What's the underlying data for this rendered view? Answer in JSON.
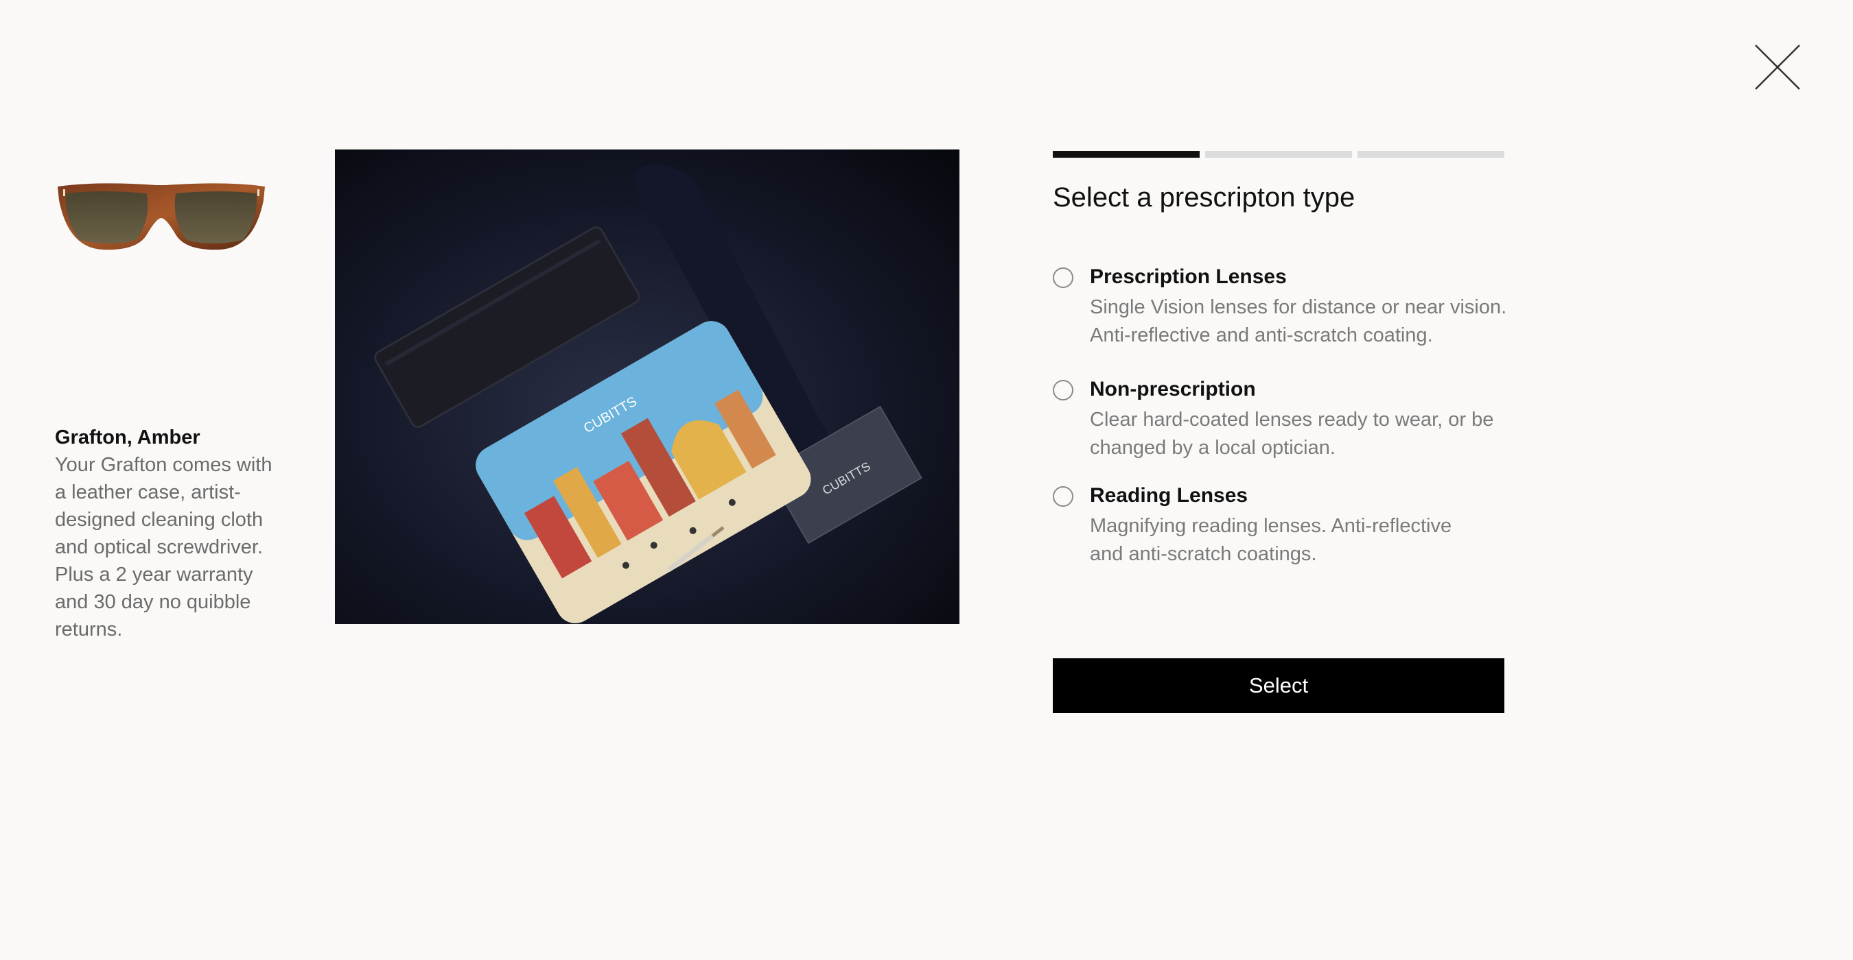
{
  "product": {
    "name": "Grafton, Amber",
    "description": "Your Grafton comes with a leather case, artist-designed cleaning cloth and optical screwdriver. Plus a 2 year warranty and 30 day no quibble returns."
  },
  "photo": {
    "cloth_brand": "CUBITTS",
    "card_brand": "CUBITTS"
  },
  "stepper": {
    "total_steps": 3,
    "current_step": 1
  },
  "panel": {
    "title": "Select a prescripton type",
    "options": [
      {
        "title": "Prescription Lenses",
        "desc_line1": "Single Vision lenses for distance or near vision.",
        "desc_line2": "Anti-reflective and anti-scratch coating."
      },
      {
        "title": "Non-prescription",
        "desc_line1": "Clear hard-coated lenses ready to wear, or be",
        "desc_line2": "changed by a local optician."
      },
      {
        "title": "Reading Lenses",
        "desc_line1": "Magnifying reading lenses. Anti-reflective",
        "desc_line2": "and anti-scratch coatings."
      }
    ],
    "select_label": "Select"
  },
  "icons": {
    "close": "close-icon",
    "radio": "radio-unchecked-icon"
  },
  "colors": {
    "background": "#faf9f7",
    "button": "#000000",
    "step_active": "#111111",
    "step_inactive": "#dcdcdc"
  }
}
